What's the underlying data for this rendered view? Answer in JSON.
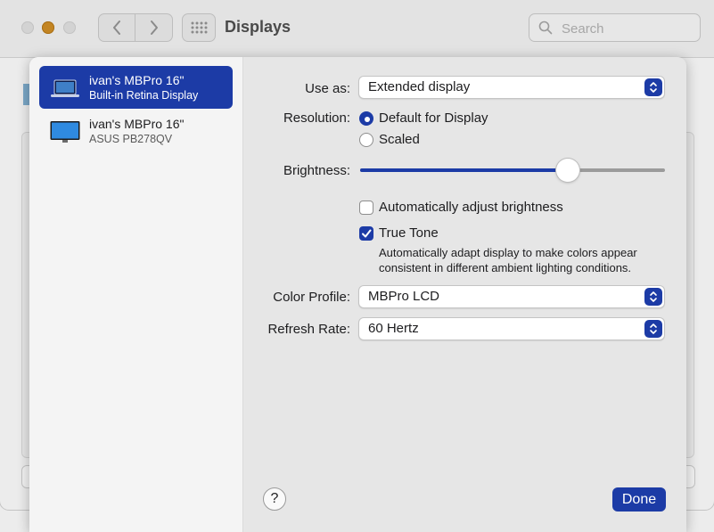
{
  "window": {
    "title": "Displays",
    "search": {
      "placeholder": "Search",
      "value": ""
    }
  },
  "sidebar": {
    "displays": [
      {
        "name": "ivan's MBPro 16\"",
        "subtitle": "Built-in Retina Display",
        "selected": true,
        "icon": "laptop-icon"
      },
      {
        "name": "ivan's MBPro 16\"",
        "subtitle": "ASUS PB278QV",
        "selected": false,
        "icon": "monitor-icon"
      }
    ]
  },
  "settings": {
    "use_as": {
      "label": "Use as:",
      "value": "Extended display"
    },
    "resolution": {
      "label": "Resolution:",
      "options": [
        {
          "label": "Default for Display",
          "selected": true
        },
        {
          "label": "Scaled",
          "selected": false
        }
      ]
    },
    "brightness": {
      "label": "Brightness:",
      "level": 0.68
    },
    "auto_brightness": {
      "label": "Automatically adjust brightness",
      "checked": false
    },
    "true_tone": {
      "label": "True Tone",
      "checked": true,
      "description": "Automatically adapt display to make colors appear consistent in different ambient lighting conditions."
    },
    "color_profile": {
      "label": "Color Profile:",
      "value": "MBPro LCD"
    },
    "refresh_rate": {
      "label": "Refresh Rate:",
      "value": "60 Hertz"
    }
  },
  "footer": {
    "help_label": "?",
    "done_label": "Done"
  },
  "colors": {
    "accent": "#1c3ba6",
    "sheet_bg": "#e6e6e6",
    "sidebar_bg": "#f4f4f4"
  }
}
